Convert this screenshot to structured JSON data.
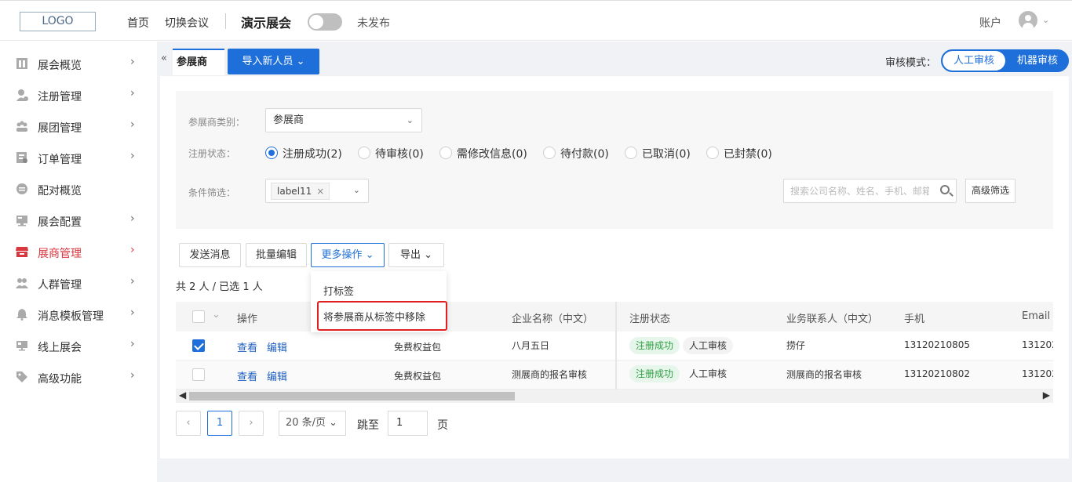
{
  "header": {
    "logo": "LOGO",
    "nav": [
      "首页",
      "切换会议"
    ],
    "event_title": "演示展会",
    "publish_status": "未发布",
    "account": "账户"
  },
  "sidebar": {
    "items": [
      {
        "label": "展会概览",
        "icon": "overview-icon",
        "arrow": "›"
      },
      {
        "label": "注册管理",
        "icon": "user-register-icon",
        "arrow": "›"
      },
      {
        "label": "展团管理",
        "icon": "group-icon",
        "arrow": "›"
      },
      {
        "label": "订单管理",
        "icon": "order-icon",
        "arrow": "›"
      },
      {
        "label": "配对概览",
        "icon": "match-icon",
        "arrow": ""
      },
      {
        "label": "展会配置",
        "icon": "config-icon",
        "arrow": "›"
      },
      {
        "label": "展商管理",
        "icon": "store-icon",
        "arrow": "›",
        "active": true
      },
      {
        "label": "人群管理",
        "icon": "people-icon",
        "arrow": "›"
      },
      {
        "label": "消息模板管理",
        "icon": "bell-icon",
        "arrow": "›"
      },
      {
        "label": "线上展会",
        "icon": "monitor-icon",
        "arrow": "›"
      },
      {
        "label": "高级功能",
        "icon": "tag-icon",
        "arrow": "›"
      }
    ],
    "active_color": "#d9363e"
  },
  "tabs": {
    "collapse": "«",
    "active": "参展商",
    "import_button": "导入新人员 ⌄"
  },
  "review_mode": {
    "label": "审核模式：",
    "options": [
      "人工审核",
      "机器审核"
    ],
    "selected": "人工审核"
  },
  "filters": {
    "type_label": "参展商类别：",
    "type_value": "参展商",
    "status_label": "注册状态：",
    "status_options": [
      "注册成功(2)",
      "待审核(0)",
      "需修改信息(0)",
      "待付款(0)",
      "已取消(0)",
      "已封禁(0)"
    ],
    "status_selected": 0,
    "condition_label": "条件筛选：",
    "condition_tag": "label11",
    "search_placeholder": "搜索公司名称、姓名、手机、邮箱",
    "advanced_filter": "高级筛选"
  },
  "actions": {
    "send_message": "发送消息",
    "batch_edit": "批量编辑",
    "more_actions": "更多操作 ⌄",
    "export": "导出 ⌄",
    "count_text": "共 2 人 / 已选 1 人"
  },
  "dropdown": {
    "items": [
      "打标签",
      "将参展商从标签中移除"
    ]
  },
  "table": {
    "columns": [
      "操作",
      "企业名称（中文）",
      "注册状态",
      "业务联系人（中文）",
      "手机",
      "Email"
    ],
    "rows": [
      {
        "checked": true,
        "view": "查看",
        "edit": "编辑",
        "package": "免费权益包",
        "company": "八月五日",
        "status": "注册成功",
        "review": "人工审核",
        "contact": "捞仔",
        "phone": "13120210805",
        "email": "131202"
      },
      {
        "checked": false,
        "view": "查看",
        "edit": "编辑",
        "package": "免费权益包",
        "company": "测展商的报名审核",
        "status": "注册成功",
        "review": "人工审核",
        "contact": "测展商的报名审核",
        "phone": "13120210802",
        "email": "131202"
      }
    ]
  },
  "pagination": {
    "current_page": "1",
    "page_size": "20 条/页 ⌄",
    "jump_label": "跳至",
    "jump_value": "1",
    "page_unit": "页"
  },
  "colors": {
    "primary": "#1e6fd9",
    "success": "#2f9e44",
    "highlight": "#e02020"
  }
}
